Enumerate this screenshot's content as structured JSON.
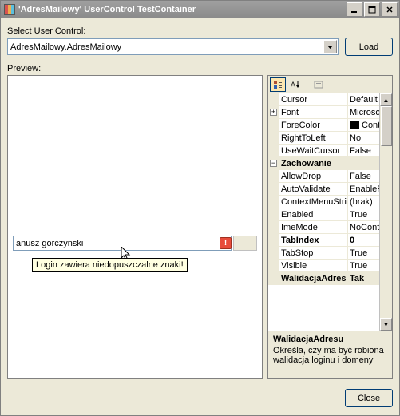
{
  "window": {
    "title": "'AdresMailowy' UserControl TestContainer"
  },
  "select_label": "Select User Control:",
  "combo_value": "AdresMailowy.AdresMailowy",
  "load_btn": "Load",
  "preview_label": "Preview:",
  "input_value": "anusz gorczynski",
  "tooltip_text": "Login zawiera niedopuszczalne znaki!",
  "close_btn": "Close",
  "propgrid": {
    "rows": [
      {
        "gutter": "",
        "name": "Cursor",
        "val": "Default",
        "cat": false
      },
      {
        "gutter": "+",
        "name": "Font",
        "val": "Microsoft",
        "cat": false
      },
      {
        "gutter": "",
        "name": "ForeColor",
        "val": "Cont",
        "swatch": true,
        "cat": false
      },
      {
        "gutter": "",
        "name": "RightToLeft",
        "val": "No",
        "cat": false
      },
      {
        "gutter": "",
        "name": "UseWaitCursor",
        "val": "False",
        "cat": false
      },
      {
        "gutter": "-",
        "name": "Zachowanie",
        "val": "",
        "cat": true
      },
      {
        "gutter": "",
        "name": "AllowDrop",
        "val": "False",
        "cat": false
      },
      {
        "gutter": "",
        "name": "AutoValidate",
        "val": "EnablePre",
        "cat": false
      },
      {
        "gutter": "",
        "name": "ContextMenuStrip",
        "val": "(brak)",
        "cat": false
      },
      {
        "gutter": "",
        "name": "Enabled",
        "val": "True",
        "cat": false
      },
      {
        "gutter": "",
        "name": "ImeMode",
        "val": "NoControl",
        "cat": false
      },
      {
        "gutter": "",
        "name": "TabIndex",
        "val": "0",
        "bold": true,
        "cat": false
      },
      {
        "gutter": "",
        "name": "TabStop",
        "val": "True",
        "cat": false
      },
      {
        "gutter": "",
        "name": "Visible",
        "val": "True",
        "cat": false
      },
      {
        "gutter": "",
        "name": "WalidacjaAdresu",
        "val": "Tak",
        "bold": true,
        "cat": false,
        "selected": true
      }
    ],
    "desc_name": "WalidacjaAdresu",
    "desc_text": "Określa, czy ma być robiona walidacja loginu i domeny"
  }
}
